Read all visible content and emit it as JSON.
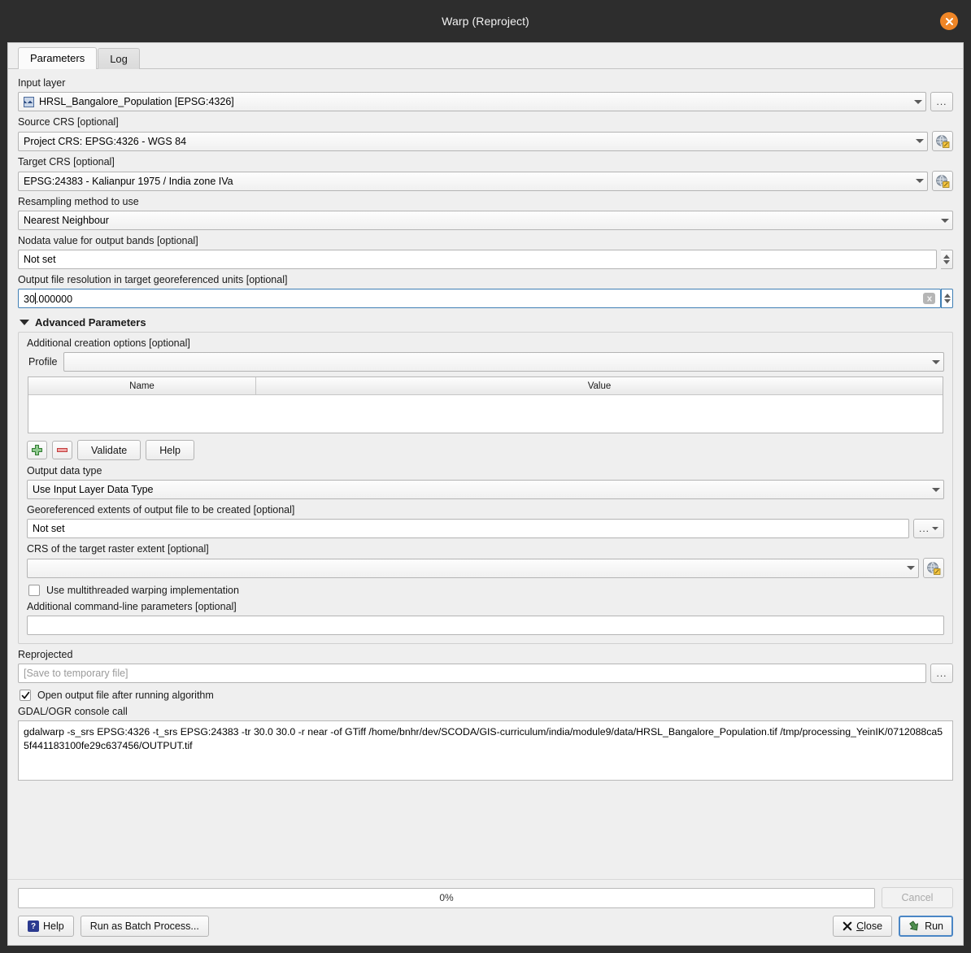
{
  "window": {
    "title": "Warp (Reproject)",
    "close_icon": "close-icon"
  },
  "tabs": [
    {
      "label": "Parameters",
      "active": true
    },
    {
      "label": "Log",
      "active": false
    }
  ],
  "parameters": {
    "input_layer": {
      "label": "Input layer",
      "value": "HRSL_Bangalore_Population [EPSG:4326]",
      "browse_label": "..."
    },
    "source_crs": {
      "label": "Source CRS [optional]",
      "value": "Project CRS: EPSG:4326 - WGS 84"
    },
    "target_crs": {
      "label": "Target CRS [optional]",
      "value": "EPSG:24383 - Kalianpur 1975 / India zone IVa"
    },
    "resampling": {
      "label": "Resampling method to use",
      "value": "Nearest Neighbour"
    },
    "nodata": {
      "label": "Nodata value for output bands [optional]",
      "value": "Not set"
    },
    "resolution": {
      "label": "Output file resolution in target georeferenced units [optional]",
      "value_before_cursor": "30",
      "value_after_cursor": ".000000"
    }
  },
  "advanced": {
    "title": "Advanced Parameters",
    "creation_options": {
      "label": "Additional creation options [optional]",
      "profile_label": "Profile",
      "profile_value": "",
      "table": {
        "columns": [
          "Name",
          "Value"
        ],
        "rows": []
      },
      "add_label": "+",
      "remove_label": "-",
      "validate_label": "Validate",
      "help_label": "Help"
    },
    "output_data_type": {
      "label": "Output data type",
      "value": "Use Input Layer Data Type"
    },
    "extents": {
      "label": "Georeferenced extents of output file to be created [optional]",
      "value": "Not set",
      "browse_label": "..."
    },
    "extent_crs": {
      "label": "CRS of the target raster extent [optional]",
      "value": ""
    },
    "multithreaded": {
      "label": "Use multithreaded warping implementation",
      "checked": false
    },
    "additional_params": {
      "label": "Additional command-line parameters [optional]",
      "value": ""
    }
  },
  "output": {
    "label": "Reprojected",
    "placeholder": "[Save to temporary file]",
    "value": "",
    "browse_label": "...",
    "open_after_run": {
      "label": "Open output file after running algorithm",
      "checked": true
    }
  },
  "console": {
    "label": "GDAL/OGR console call",
    "text": "gdalwarp -s_srs EPSG:4326 -t_srs EPSG:24383 -tr 30.0 30.0 -r near -of GTiff /home/bnhr/dev/SCODA/GIS-curriculum/india/module9/data/HRSL_Bangalore_Population.tif /tmp/processing_YeinIK/0712088ca55f441183100fe29c637456/OUTPUT.tif"
  },
  "footer": {
    "progress_text": "0%",
    "progress_value": 0,
    "cancel_label": "Cancel",
    "help_label": "Help",
    "batch_label": "Run as Batch Process...",
    "close_label": "Close",
    "run_label": "Run"
  },
  "colors": {
    "titlebar_bg": "#2d2d2d",
    "dialog_bg": "#efefef",
    "close_button": "#ef8627",
    "primary_border": "#4a86c5",
    "focus_border": "#3f7fb5"
  }
}
